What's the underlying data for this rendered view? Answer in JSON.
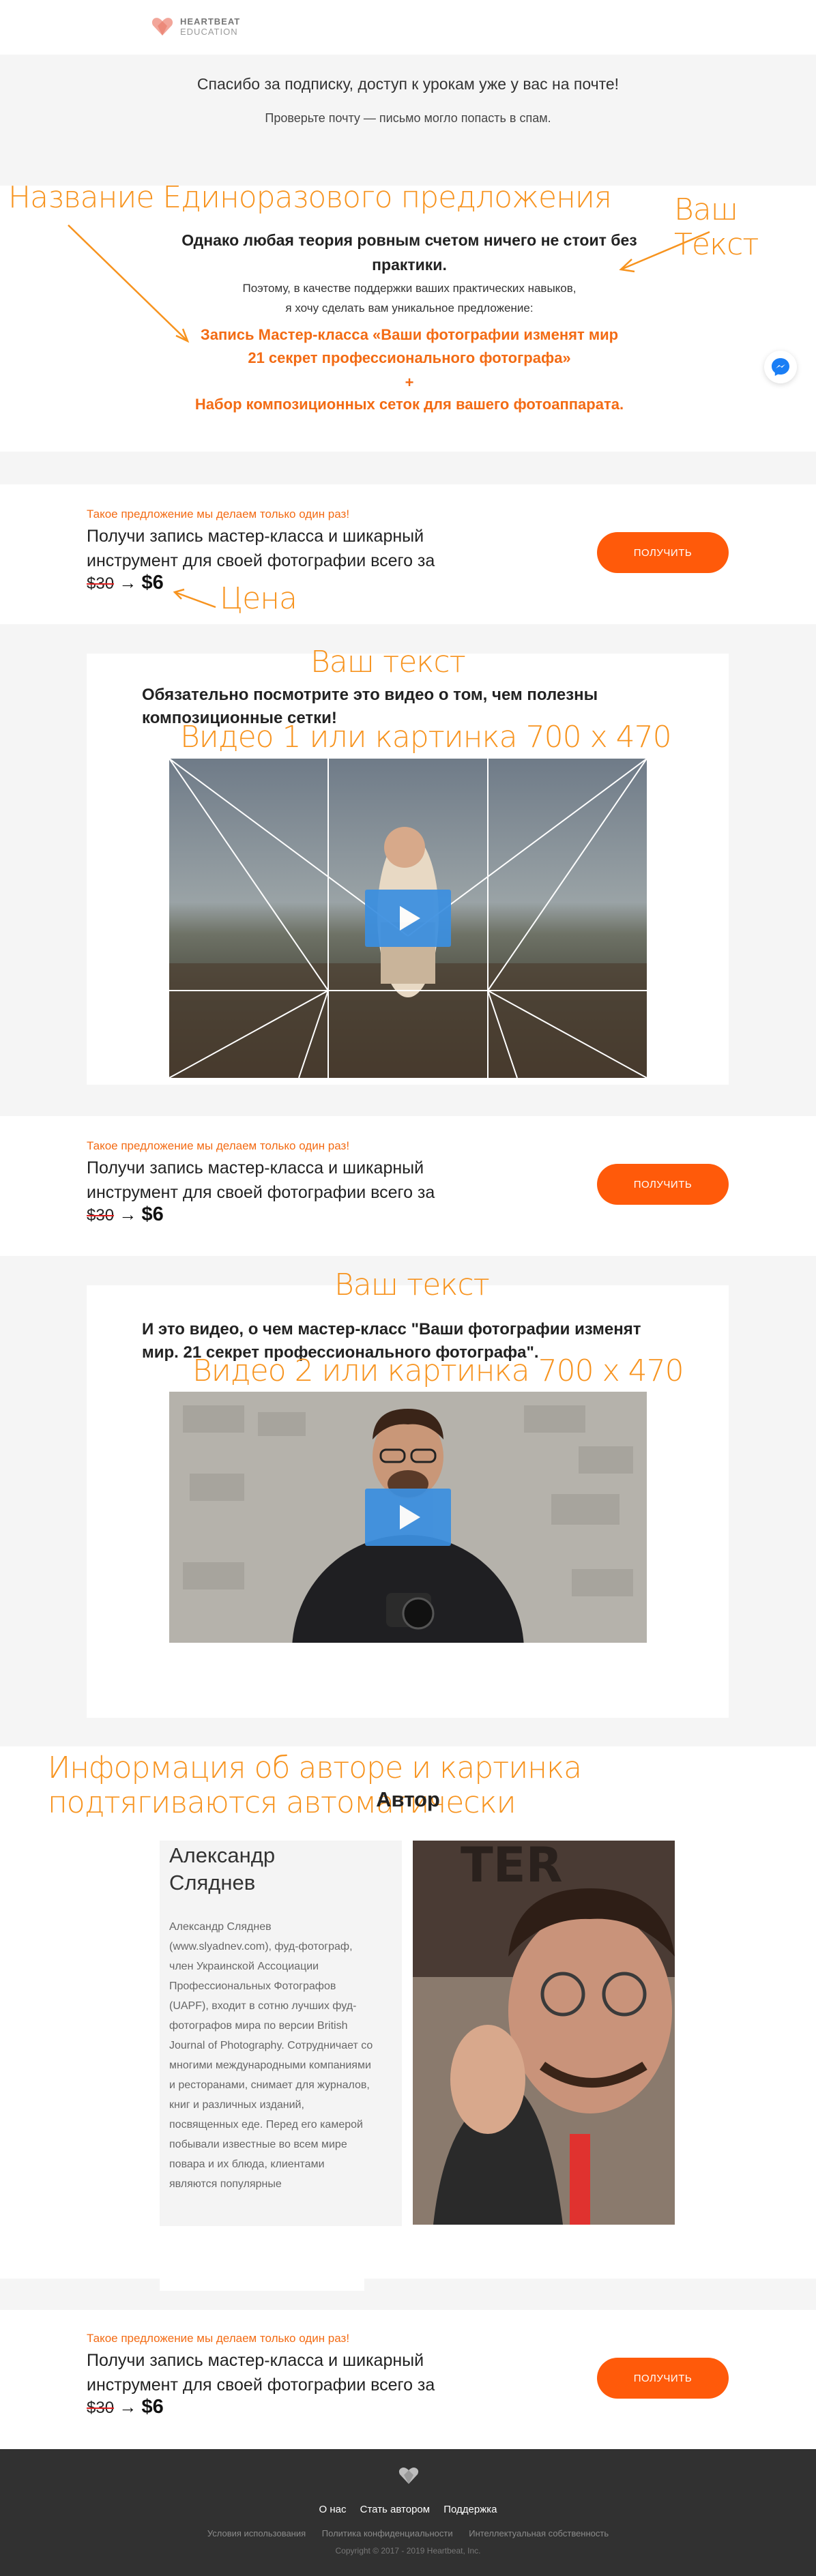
{
  "header": {
    "logo_line1": "HEARTBEAT",
    "logo_line2": "EDUCATION"
  },
  "thanks": {
    "title": "Спасибо за подписку, доступ к урокам уже у вас на почте!",
    "subtitle": "Проверьте почту — письмо могло попасть в спам."
  },
  "offer": {
    "heading": "Однако любая теория ровным счетом ничего не стоит без практики.",
    "p1": "Поэтому, в качестве поддержки ваших практических навыков,",
    "p2": "я хочу сделать вам уникальное предложение:",
    "line1": "Запись Мастер-класса «Ваши фотографии изменят мир",
    "line2": "21 секрет профессионального фотографа»",
    "plus": "+",
    "line3": "Набор композиционных сеток для вашего фотоаппарата."
  },
  "annotations": {
    "offer_name": "Название Единоразового предложения",
    "your_text_1": "Ваш Текст",
    "price": "Цена",
    "your_text_2": "Ваш текст",
    "video1": "Видео 1 или картинка 700 х 470",
    "your_text_3": "Ваш текст",
    "video2": "Видео 2 или картинка 700 х 470",
    "author_auto": "Информация об авторе и картинка подтягиваются автоматически"
  },
  "cta": {
    "once": "Такое предложение мы делаем только один раз!",
    "text": "Получи запись мастер-класса и шикарный инструмент для своей фотографии всего за",
    "old_price": "$30",
    "arrow": "→",
    "new_price": "$6",
    "button": "ПОЛУЧИТЬ"
  },
  "video1": {
    "heading": "Обязательно посмотрите это видео о том, чем полезны композиционные сетки!"
  },
  "video2": {
    "heading": "И это видео, о чем мастер-класс \"Ваши фотографии изменят мир. 21 секрет профессионального фотографа\"."
  },
  "author": {
    "section_title": "Автор",
    "name": "Александр Сляднев",
    "bio": "Александр Сляднев (www.slyadnev.com), фуд-фотограф, член Украинской Ассоциации Профессиональных Фотографов (UAPF), входит в сотню лучших фуд-фотографов мира по версии British Journal of Photography. Сотрудничает со многими международными компаниями и ресторанами, снимает для журналов, книг и различных изданий, посвященных еде. Перед его камерой побывали известные во всем мире повара и их блюда, клиентами являются популярные"
  },
  "footer": {
    "links": [
      "О нас",
      "Стать автором",
      "Поддержка"
    ],
    "legal": [
      "Условия использования",
      "Политика конфиденциальности",
      "Интеллектуальная собственность"
    ],
    "copyright": "Copyright © 2017 - 2019 Heartbeat, Inc."
  },
  "colors": {
    "accent": "#ff5a0a",
    "annotation": "#f7931e",
    "footer_bg": "#313131"
  }
}
